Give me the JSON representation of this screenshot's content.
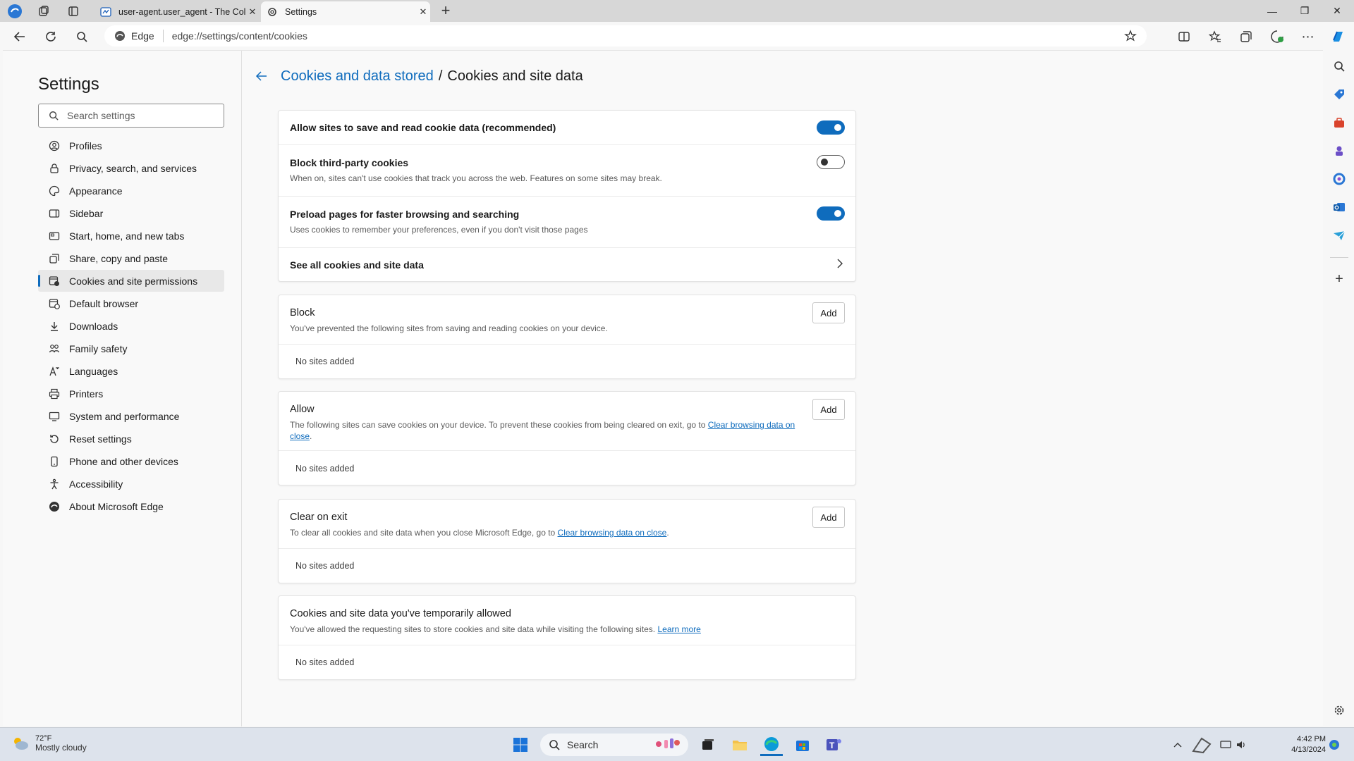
{
  "browser": {
    "tabs": [
      {
        "title": "user-agent.user_agent - The Coll",
        "active": false
      },
      {
        "title": "Settings",
        "active": true
      }
    ],
    "address": {
      "chip": "Edge",
      "url": "edge://settings/content/cookies"
    }
  },
  "sidebar": {
    "title": "Settings",
    "search_placeholder": "Search settings",
    "items": [
      {
        "label": "Profiles",
        "icon": "profile-icon"
      },
      {
        "label": "Privacy, search, and services",
        "icon": "lock-icon"
      },
      {
        "label": "Appearance",
        "icon": "appearance-icon"
      },
      {
        "label": "Sidebar",
        "icon": "sidebar-icon"
      },
      {
        "label": "Start, home, and new tabs",
        "icon": "home-icon"
      },
      {
        "label": "Share, copy and paste",
        "icon": "share-icon"
      },
      {
        "label": "Cookies and site permissions",
        "icon": "cookie-icon",
        "selected": true
      },
      {
        "label": "Default browser",
        "icon": "browser-icon"
      },
      {
        "label": "Downloads",
        "icon": "download-icon"
      },
      {
        "label": "Family safety",
        "icon": "family-icon"
      },
      {
        "label": "Languages",
        "icon": "language-icon"
      },
      {
        "label": "Printers",
        "icon": "printer-icon"
      },
      {
        "label": "System and performance",
        "icon": "system-icon"
      },
      {
        "label": "Reset settings",
        "icon": "reset-icon"
      },
      {
        "label": "Phone and other devices",
        "icon": "phone-icon"
      },
      {
        "label": "Accessibility",
        "icon": "accessibility-icon"
      },
      {
        "label": "About Microsoft Edge",
        "icon": "edge-icon"
      }
    ]
  },
  "breadcrumb": {
    "parent": "Cookies and data stored",
    "separator": "/",
    "current": "Cookies and site data"
  },
  "settings": {
    "allow_sites": {
      "title": "Allow sites to save and read cookie data (recommended)",
      "enabled": true
    },
    "block_third_party": {
      "title": "Block third-party cookies",
      "desc": "When on, sites can't use cookies that track you across the web. Features on some sites may break.",
      "enabled": false
    },
    "preload": {
      "title": "Preload pages for faster browsing and searching",
      "desc": "Uses cookies to remember your preferences, even if you don't visit those pages",
      "enabled": true
    },
    "see_all": {
      "title": "See all cookies and site data"
    }
  },
  "sections": {
    "block": {
      "title": "Block",
      "desc": "You've prevented the following sites from saving and reading cookies on your device.",
      "add": "Add",
      "empty": "No sites added"
    },
    "allow": {
      "title": "Allow",
      "desc_pre": "The following sites can save cookies on your device. To prevent these cookies from being cleared on exit, go to ",
      "link": "Clear browsing data on close",
      "desc_post": ".",
      "add": "Add",
      "empty": "No sites added"
    },
    "clear_on_exit": {
      "title": "Clear on exit",
      "desc_pre": "To clear all cookies and site data when you close Microsoft Edge, go to ",
      "link": "Clear browsing data on close",
      "desc_post": ".",
      "add": "Add",
      "empty": "No sites added"
    },
    "temporary": {
      "title": "Cookies and site data you've temporarily allowed",
      "desc_pre": "You've allowed the requesting sites to store cookies and site data while visiting the following sites. ",
      "link": "Learn more",
      "empty": "No sites added"
    }
  },
  "taskbar": {
    "weather": {
      "temp": "72°F",
      "condition": "Mostly cloudy"
    },
    "search": "Search",
    "time": "4:42 PM",
    "date": "4/13/2024"
  },
  "colors": {
    "accent": "#0f6cbd"
  }
}
